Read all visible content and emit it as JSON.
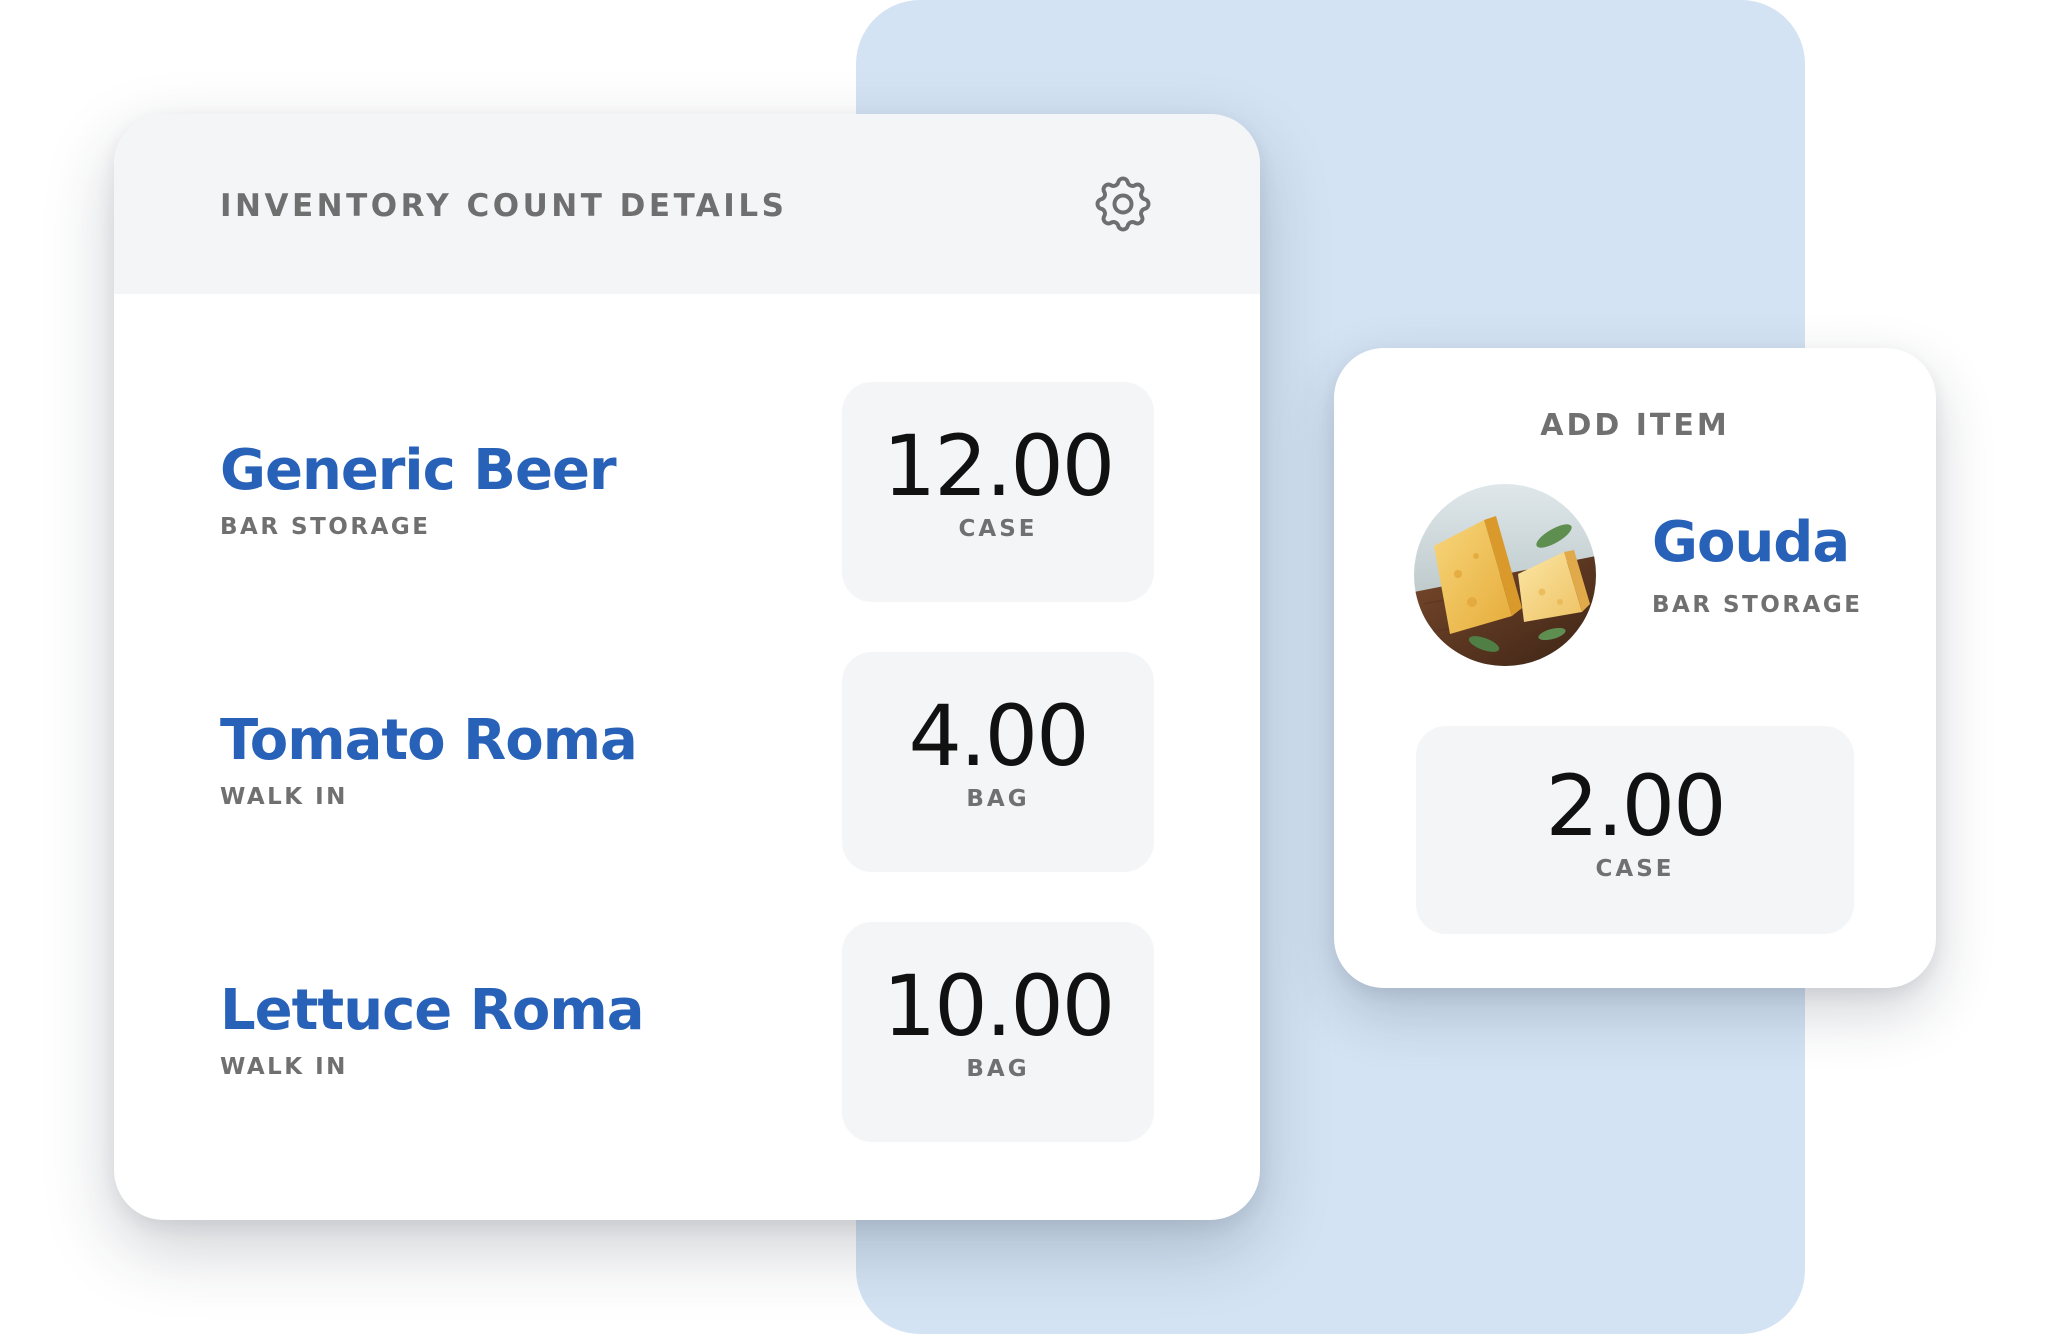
{
  "inventory_card": {
    "title": "INVENTORY COUNT DETAILS",
    "items": [
      {
        "name": "Generic Beer",
        "location": "BAR STORAGE",
        "quantity": "12.00",
        "unit": "CASE"
      },
      {
        "name": "Tomato Roma",
        "location": "WALK IN",
        "quantity": "4.00",
        "unit": "BAG"
      },
      {
        "name": "Lettuce Roma",
        "location": "WALK IN",
        "quantity": "10.00",
        "unit": "BAG"
      }
    ]
  },
  "add_item_card": {
    "title": "ADD ITEM",
    "item": {
      "name": "Gouda",
      "location": "BAR STORAGE",
      "quantity": "2.00",
      "unit": "CASE"
    }
  },
  "icons": {
    "settings": "gear-icon",
    "item_image": "gouda-cheese-image"
  },
  "colors": {
    "accent_blue": "#2861b8",
    "background_panel": "#d3e3f3",
    "label_gray": "#707070",
    "box_gray": "#f4f5f7"
  }
}
